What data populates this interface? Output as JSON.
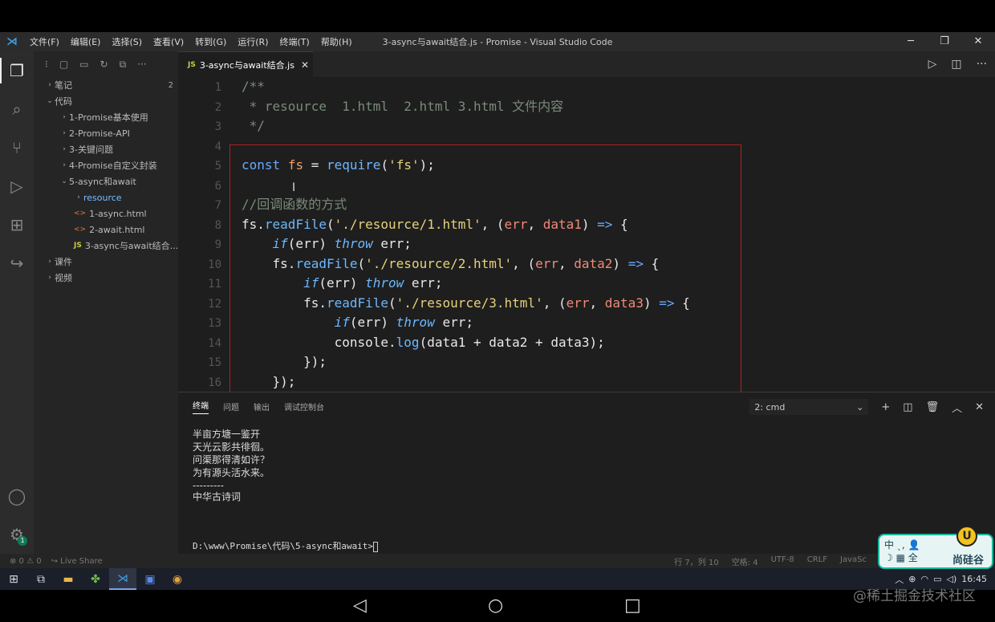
{
  "window": {
    "title": "3-async与await结合.js - Promise - Visual Studio Code",
    "menu": [
      "文件(F)",
      "编辑(E)",
      "选择(S)",
      "查看(V)",
      "转到(G)",
      "运行(R)",
      "终端(T)",
      "帮助(H)"
    ]
  },
  "sidebar": {
    "tree": [
      {
        "label": "笔记",
        "chev": ">",
        "indent": 0,
        "count": "2"
      },
      {
        "label": "代码",
        "chev": "v",
        "indent": 0
      },
      {
        "label": "1-Promise基本使用",
        "chev": ">",
        "indent": 1
      },
      {
        "label": "2-Promise-API",
        "chev": ">",
        "indent": 1
      },
      {
        "label": "3-关键问题",
        "chev": ">",
        "indent": 1
      },
      {
        "label": "4-Promise自定义封装",
        "chev": ">",
        "indent": 1
      },
      {
        "label": "5-async和await",
        "chev": "v",
        "indent": 1
      },
      {
        "label": "resource",
        "chev": ">",
        "indent": 2,
        "selected": true
      },
      {
        "label": "1-async.html",
        "icon": "<>",
        "indent": 2
      },
      {
        "label": "2-await.html",
        "icon": "<>",
        "indent": 2
      },
      {
        "label": "3-async与await结合...",
        "icon": "JS",
        "indent": 2
      },
      {
        "label": "课件",
        "chev": ">",
        "indent": 0
      },
      {
        "label": "视频",
        "chev": ">",
        "indent": 0
      }
    ]
  },
  "editor": {
    "tab_label": "3-async与await结合.js",
    "tab_icon": "JS",
    "tab_close": "✕",
    "lines": [
      {
        "n": "1",
        "html": "<span class='c-com'>/**</span>"
      },
      {
        "n": "2",
        "html": "<span class='c-com'> * resource  1.html  2.html 3.html 文件内容</span>"
      },
      {
        "n": "3",
        "html": "<span class='c-com'> */</span>"
      },
      {
        "n": "4",
        "html": ""
      },
      {
        "n": "5",
        "html": "<span class='c-kw'>const</span> <span class='c-var'>fs</span> <span class='c-op'>=</span> <span class='c-fn'>require</span><span class='c-pl'>(</span><span class='c-str'>'fs'</span><span class='c-pl'>);</span>"
      },
      {
        "n": "6",
        "html": ""
      },
      {
        "n": "7",
        "html": "<span class='c-com'>//回调函数的方式</span>"
      },
      {
        "n": "8",
        "html": "<span class='c-pl'>fs.</span><span class='c-fn'>readFile</span><span class='c-pl'>(</span><span class='c-str'>'./resource/1.html'</span><span class='c-pl'>, (</span><span class='c-para'>err</span><span class='c-pl'>, </span><span class='c-para'>data1</span><span class='c-pl'>) </span><span class='c-kw'>=&gt;</span><span class='c-pl'> {</span>"
      },
      {
        "n": "9",
        "html": "<span class='c-pl'>    </span><span class='c-it'>if</span><span class='c-pl'>(err) </span><span class='c-it'>throw</span><span class='c-pl'> err;</span>"
      },
      {
        "n": "10",
        "html": "<span class='c-pl'>    fs.</span><span class='c-fn'>readFile</span><span class='c-pl'>(</span><span class='c-str'>'./resource/2.html'</span><span class='c-pl'>, (</span><span class='c-para'>err</span><span class='c-pl'>, </span><span class='c-para'>data2</span><span class='c-pl'>) </span><span class='c-kw'>=&gt;</span><span class='c-pl'> {</span>"
      },
      {
        "n": "11",
        "html": "<span class='c-pl'>        </span><span class='c-it'>if</span><span class='c-pl'>(err) </span><span class='c-it'>throw</span><span class='c-pl'> err;</span>"
      },
      {
        "n": "12",
        "html": "<span class='c-pl'>        fs.</span><span class='c-fn'>readFile</span><span class='c-pl'>(</span><span class='c-str'>'./resource/3.html'</span><span class='c-pl'>, (</span><span class='c-para'>err</span><span class='c-pl'>, </span><span class='c-para'>data3</span><span class='c-pl'>) </span><span class='c-kw'>=&gt;</span><span class='c-pl'> {</span>"
      },
      {
        "n": "13",
        "html": "<span class='c-pl'>            </span><span class='c-it'>if</span><span class='c-pl'>(err) </span><span class='c-it'>throw</span><span class='c-pl'> err;</span>"
      },
      {
        "n": "14",
        "html": "<span class='c-pl'>            console.</span><span class='c-fn'>log</span><span class='c-pl'>(data1 + data2 + data3);</span>"
      },
      {
        "n": "15",
        "html": "<span class='c-pl'>        });</span>"
      },
      {
        "n": "16",
        "html": "<span class='c-pl'>    });</span>"
      }
    ]
  },
  "panel": {
    "tabs": [
      "终端",
      "问题",
      "输出",
      "调试控制台"
    ],
    "terminal_select": "2: cmd",
    "output": [
      "半亩方塘一鉴开",
      "天光云影共徘徊。",
      "问渠那得清如许？",
      "为有源头活水来。",
      "---------",
      "中华古诗词"
    ],
    "prompt": "D:\\www\\Promise\\代码\\5-async和await>"
  },
  "statusbar": {
    "errors": "⊗ 0 ⚠ 0",
    "liveshare": "Live Share",
    "position": "行 7，列 10",
    "spaces": "空格: 4",
    "encoding": "UTF-8",
    "eol": "CRLF",
    "language": "JavaSc"
  },
  "taskbar": {
    "time": "16:45"
  },
  "overlay": {
    "left_line1": "中 ˎ, 👤",
    "left_line2": "☽ ▦ 全",
    "right": "尚硅谷",
    "badge": "U"
  },
  "watermark": "@稀土掘金技术社区"
}
